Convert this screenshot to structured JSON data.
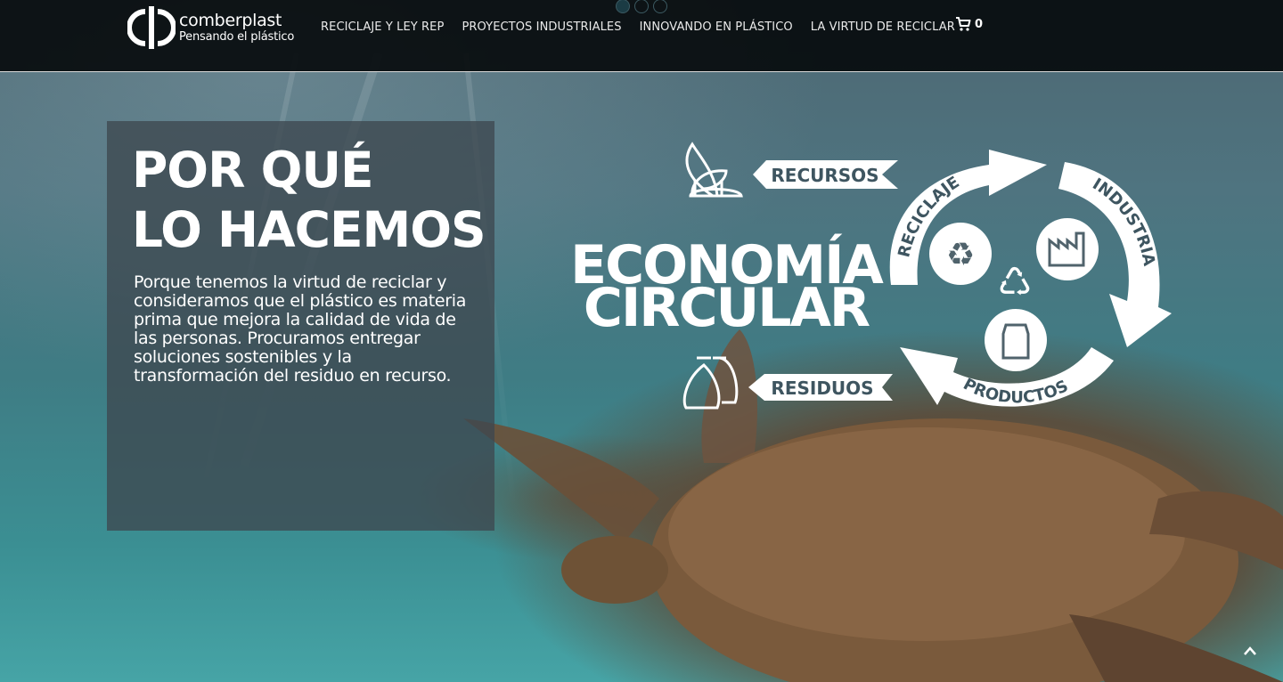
{
  "brand": {
    "name": "comberplast",
    "tagline": "Pensando el plástico"
  },
  "nav": {
    "items": [
      {
        "label": "RECICLAJE Y LEY REP"
      },
      {
        "label": "PROYECTOS INDUSTRIALES"
      },
      {
        "label": "INNOVANDO EN PLÁSTICO"
      },
      {
        "label": "LA VIRTUD DE RECICLAR"
      }
    ],
    "cart_count": "0"
  },
  "slider": {
    "dots": 3,
    "active_dot": 1
  },
  "hero": {
    "title_line1": "POR QUÉ",
    "title_line2": "LO HACEMOS",
    "text": "Porque tenemos la virtud de reciclar y consideramos que el plástico es materia prima que mejora la calidad de vida de las personas. Procuramos entregar soluciones sostenibles y la transformación del residuo en recurso."
  },
  "diagram": {
    "title_line1": "ECONOMÍA",
    "title_line2": "CIRCULAR",
    "recursos": "RECURSOS",
    "residuos": "RESIDUOS",
    "reciclaje": "RECICLAJE",
    "industria": "INDUSTRIA",
    "productos": "PRODUCTOS"
  },
  "colors": {
    "navbar_bg": "#080c0e",
    "card_bg": "#3e4850",
    "text": "#ffffff",
    "water_teal": "#3b8f93"
  },
  "icons": [
    "logo-mark-icon",
    "cart-icon",
    "sprout-icon",
    "bags-icon",
    "recycle-icon",
    "factory-icon",
    "milk-carton-icon",
    "chevron-up-icon"
  ]
}
